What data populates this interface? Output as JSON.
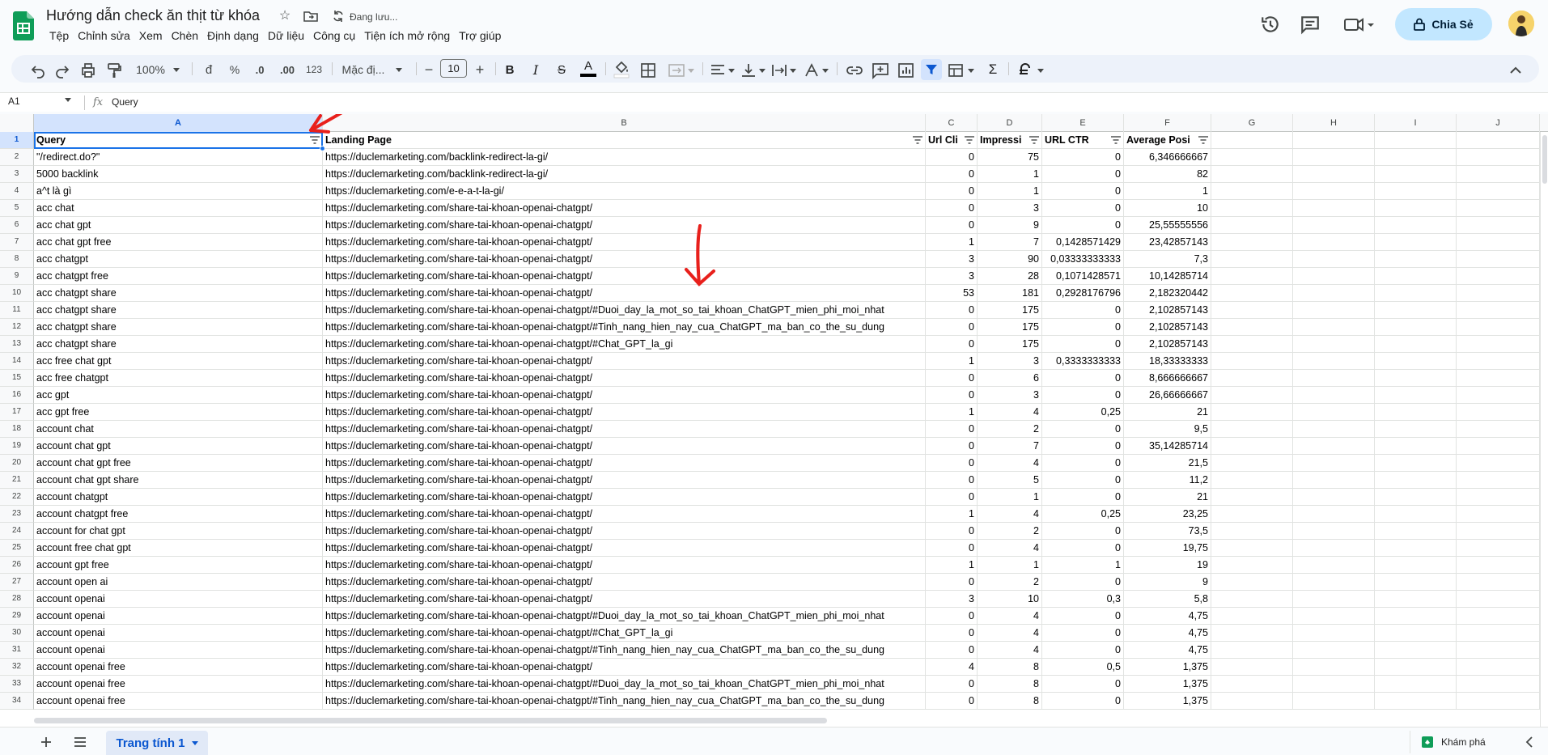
{
  "app": {
    "doc_title": "Hướng dẫn check ăn thịt từ khóa",
    "saving_status": "Đang lưu...",
    "share_label": "Chia Sẻ"
  },
  "menu": [
    "Tệp",
    "Chỉnh sửa",
    "Xem",
    "Chèn",
    "Định dạng",
    "Dữ liệu",
    "Công cụ",
    "Tiện ích mở rộng",
    "Trợ giúp"
  ],
  "toolbar": {
    "zoom": "100%",
    "currency": "đ",
    "percent": "%",
    "dec_decrease": ".0",
    "dec_increase": ".00",
    "num_format": "123",
    "font": "Mặc đị...",
    "font_size": "10",
    "minus": "−",
    "plus": "+",
    "bold": "B",
    "italic": "I",
    "strike": "S",
    "textcolor": "A",
    "sigma": "Σ"
  },
  "formula_bar": {
    "name_box": "A1",
    "fx": "fx",
    "content": "Query"
  },
  "columns": [
    "A",
    "B",
    "C",
    "D",
    "E",
    "F",
    "G",
    "H",
    "I",
    "J"
  ],
  "header_row": {
    "row_num": "1",
    "cells": [
      "Query",
      "Landing Page",
      "Url Cli",
      "Impressi",
      "URL CTR",
      "Average Posi"
    ]
  },
  "rows": [
    {
      "n": "2",
      "q": "\"/redirect.do?\"",
      "url": "https://duclemarketing.com/backlink-redirect-la-gi/",
      "c": "0",
      "d": "75",
      "e": "0",
      "f": "6,346666667"
    },
    {
      "n": "3",
      "q": "5000 backlink",
      "url": "https://duclemarketing.com/backlink-redirect-la-gi/",
      "c": "0",
      "d": "1",
      "e": "0",
      "f": "82"
    },
    {
      "n": "4",
      "q": "a^t là gì",
      "url": "https://duclemarketing.com/e-e-a-t-la-gi/",
      "c": "0",
      "d": "1",
      "e": "0",
      "f": "1"
    },
    {
      "n": "5",
      "q": "acc chat",
      "url": "https://duclemarketing.com/share-tai-khoan-openai-chatgpt/",
      "c": "0",
      "d": "3",
      "e": "0",
      "f": "10"
    },
    {
      "n": "6",
      "q": "acc chat gpt",
      "url": "https://duclemarketing.com/share-tai-khoan-openai-chatgpt/",
      "c": "0",
      "d": "9",
      "e": "0",
      "f": "25,55555556"
    },
    {
      "n": "7",
      "q": "acc chat gpt free",
      "url": "https://duclemarketing.com/share-tai-khoan-openai-chatgpt/",
      "c": "1",
      "d": "7",
      "e": "0,1428571429",
      "f": "23,42857143"
    },
    {
      "n": "8",
      "q": "acc chatgpt",
      "url": "https://duclemarketing.com/share-tai-khoan-openai-chatgpt/",
      "c": "3",
      "d": "90",
      "e": "0,03333333333",
      "f": "7,3"
    },
    {
      "n": "9",
      "q": "acc chatgpt free",
      "url": "https://duclemarketing.com/share-tai-khoan-openai-chatgpt/",
      "c": "3",
      "d": "28",
      "e": "0,1071428571",
      "f": "10,14285714"
    },
    {
      "n": "10",
      "q": "acc chatgpt share",
      "url": "https://duclemarketing.com/share-tai-khoan-openai-chatgpt/",
      "c": "53",
      "d": "181",
      "e": "0,2928176796",
      "f": "2,182320442"
    },
    {
      "n": "11",
      "q": "acc chatgpt share",
      "url": "https://duclemarketing.com/share-tai-khoan-openai-chatgpt/#Duoi_day_la_mot_so_tai_khoan_ChatGPT_mien_phi_moi_nhat",
      "c": "0",
      "d": "175",
      "e": "0",
      "f": "2,102857143"
    },
    {
      "n": "12",
      "q": "acc chatgpt share",
      "url": "https://duclemarketing.com/share-tai-khoan-openai-chatgpt/#Tinh_nang_hien_nay_cua_ChatGPT_ma_ban_co_the_su_dung",
      "c": "0",
      "d": "175",
      "e": "0",
      "f": "2,102857143"
    },
    {
      "n": "13",
      "q": "acc chatgpt share",
      "url": "https://duclemarketing.com/share-tai-khoan-openai-chatgpt/#Chat_GPT_la_gi",
      "c": "0",
      "d": "175",
      "e": "0",
      "f": "2,102857143"
    },
    {
      "n": "14",
      "q": "acc free chat gpt",
      "url": "https://duclemarketing.com/share-tai-khoan-openai-chatgpt/",
      "c": "1",
      "d": "3",
      "e": "0,3333333333",
      "f": "18,33333333"
    },
    {
      "n": "15",
      "q": "acc free chatgpt",
      "url": "https://duclemarketing.com/share-tai-khoan-openai-chatgpt/",
      "c": "0",
      "d": "6",
      "e": "0",
      "f": "8,666666667"
    },
    {
      "n": "16",
      "q": "acc gpt",
      "url": "https://duclemarketing.com/share-tai-khoan-openai-chatgpt/",
      "c": "0",
      "d": "3",
      "e": "0",
      "f": "26,66666667"
    },
    {
      "n": "17",
      "q": "acc gpt free",
      "url": "https://duclemarketing.com/share-tai-khoan-openai-chatgpt/",
      "c": "1",
      "d": "4",
      "e": "0,25",
      "f": "21"
    },
    {
      "n": "18",
      "q": "account chat",
      "url": "https://duclemarketing.com/share-tai-khoan-openai-chatgpt/",
      "c": "0",
      "d": "2",
      "e": "0",
      "f": "9,5"
    },
    {
      "n": "19",
      "q": "account chat gpt",
      "url": "https://duclemarketing.com/share-tai-khoan-openai-chatgpt/",
      "c": "0",
      "d": "7",
      "e": "0",
      "f": "35,14285714"
    },
    {
      "n": "20",
      "q": "account chat gpt free",
      "url": "https://duclemarketing.com/share-tai-khoan-openai-chatgpt/",
      "c": "0",
      "d": "4",
      "e": "0",
      "f": "21,5"
    },
    {
      "n": "21",
      "q": "account chat gpt share",
      "url": "https://duclemarketing.com/share-tai-khoan-openai-chatgpt/",
      "c": "0",
      "d": "5",
      "e": "0",
      "f": "11,2"
    },
    {
      "n": "22",
      "q": "account chatgpt",
      "url": "https://duclemarketing.com/share-tai-khoan-openai-chatgpt/",
      "c": "0",
      "d": "1",
      "e": "0",
      "f": "21"
    },
    {
      "n": "23",
      "q": "account chatgpt free",
      "url": "https://duclemarketing.com/share-tai-khoan-openai-chatgpt/",
      "c": "1",
      "d": "4",
      "e": "0,25",
      "f": "23,25"
    },
    {
      "n": "24",
      "q": "account for chat gpt",
      "url": "https://duclemarketing.com/share-tai-khoan-openai-chatgpt/",
      "c": "0",
      "d": "2",
      "e": "0",
      "f": "73,5"
    },
    {
      "n": "25",
      "q": "account free chat gpt",
      "url": "https://duclemarketing.com/share-tai-khoan-openai-chatgpt/",
      "c": "0",
      "d": "4",
      "e": "0",
      "f": "19,75"
    },
    {
      "n": "26",
      "q": "account gpt free",
      "url": "https://duclemarketing.com/share-tai-khoan-openai-chatgpt/",
      "c": "1",
      "d": "1",
      "e": "1",
      "f": "19"
    },
    {
      "n": "27",
      "q": "account open ai",
      "url": "https://duclemarketing.com/share-tai-khoan-openai-chatgpt/",
      "c": "0",
      "d": "2",
      "e": "0",
      "f": "9"
    },
    {
      "n": "28",
      "q": "account openai",
      "url": "https://duclemarketing.com/share-tai-khoan-openai-chatgpt/",
      "c": "3",
      "d": "10",
      "e": "0,3",
      "f": "5,8"
    },
    {
      "n": "29",
      "q": "account openai",
      "url": "https://duclemarketing.com/share-tai-khoan-openai-chatgpt/#Duoi_day_la_mot_so_tai_khoan_ChatGPT_mien_phi_moi_nhat",
      "c": "0",
      "d": "4",
      "e": "0",
      "f": "4,75"
    },
    {
      "n": "30",
      "q": "account openai",
      "url": "https://duclemarketing.com/share-tai-khoan-openai-chatgpt/#Chat_GPT_la_gi",
      "c": "0",
      "d": "4",
      "e": "0",
      "f": "4,75"
    },
    {
      "n": "31",
      "q": "account openai",
      "url": "https://duclemarketing.com/share-tai-khoan-openai-chatgpt/#Tinh_nang_hien_nay_cua_ChatGPT_ma_ban_co_the_su_dung",
      "c": "0",
      "d": "4",
      "e": "0",
      "f": "4,75"
    },
    {
      "n": "32",
      "q": "account openai free",
      "url": "https://duclemarketing.com/share-tai-khoan-openai-chatgpt/",
      "c": "4",
      "d": "8",
      "e": "0,5",
      "f": "1,375"
    },
    {
      "n": "33",
      "q": "account openai free",
      "url": "https://duclemarketing.com/share-tai-khoan-openai-chatgpt/#Duoi_day_la_mot_so_tai_khoan_ChatGPT_mien_phi_moi_nhat",
      "c": "0",
      "d": "8",
      "e": "0",
      "f": "1,375"
    },
    {
      "n": "34",
      "q": "account openai free",
      "url": "https://duclemarketing.com/share-tai-khoan-openai-chatgpt/#Tinh_nang_hien_nay_cua_ChatGPT_ma_ban_co_the_su_dung",
      "c": "0",
      "d": "8",
      "e": "0",
      "f": "1,375"
    }
  ],
  "bottom": {
    "sheet_tab": "Trang tính 1",
    "explore": "Khám phá"
  },
  "colors": {
    "accent": "#0b57d0",
    "share_bg": "#c2e7ff",
    "annotation_red": "#e8201c",
    "sheets_green": "#0f9d58"
  }
}
